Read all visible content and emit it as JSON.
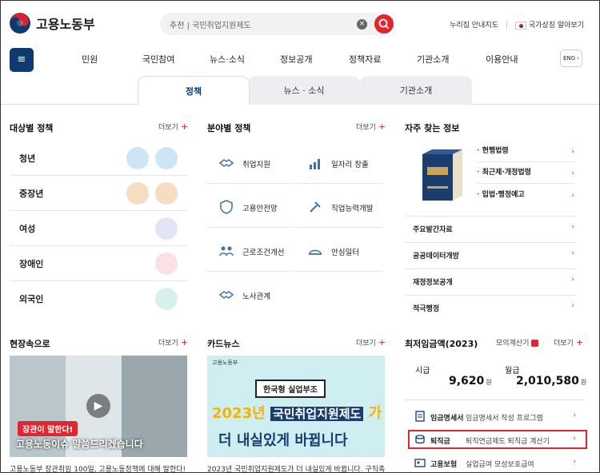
{
  "header": {
    "logo_text": "고용노동부",
    "search_text": "추천 | 국민취업지원제도",
    "links": [
      "누리집 안내지도",
      "국가상징 알아보기"
    ]
  },
  "nav": {
    "items": [
      "민원",
      "국민참여",
      "뉴스·소식",
      "정보공개",
      "정책자료",
      "기관소개",
      "이용안내"
    ],
    "eng": "ENG"
  },
  "tabs": [
    "정책",
    "뉴스 · 소식",
    "기관소개"
  ],
  "target_policy": {
    "title": "대상별 정책",
    "more": "더보기",
    "items": [
      "청년",
      "중장년",
      "여성",
      "장애인",
      "외국인"
    ]
  },
  "field_policy": {
    "title": "분야별 정책",
    "more": "더보기",
    "items": [
      "취업지원",
      "일자리 창출",
      "고용안전망",
      "직업능력개발",
      "근로조건개선",
      "안심일터",
      "노사관계"
    ]
  },
  "frequent": {
    "title": "자주 찾는 정보",
    "law_items": [
      "현행법령",
      "최근제·개정법령",
      "입법·행정예고"
    ],
    "items": [
      "주요발간자료",
      "공공데이터개방",
      "재정정보공개",
      "적극행정"
    ]
  },
  "field": {
    "title": "현장속으로",
    "more": "더보기",
    "video_text": "고용노동이슈 말씀드리겠습니다",
    "video_badge": "장관이 말한다!",
    "caption": "고용노동부 장관취임 100일, 고용노동정책에 대해 말한다!"
  },
  "cardnews": {
    "title": "카드뉴스",
    "more": "더보기",
    "small_logo": "고용노동부",
    "badge": "한국형 실업부조",
    "line1_year": "2023년",
    "line1_name": "국민취업지원제도",
    "line1_end": "가",
    "line2": "더 내실있게 바뀝니다",
    "caption": "2023년 국민취업지원제도가 더 내실있게 바뀝니다. 구직촉진"
  },
  "minwage": {
    "title": "최저임금액(2023)",
    "calc": "모의계산기",
    "more": "더보기",
    "hourly_label": "시급",
    "hourly_value": "9,620",
    "monthly_label": "월급",
    "monthly_value": "2,010,580",
    "unit": "원"
  },
  "utilities": [
    {
      "name": "임금명세서",
      "desc": "임금명세서 작성 프로그램"
    },
    {
      "name": "퇴직금",
      "desc": "퇴직연금제도 퇴직금 계산기"
    },
    {
      "name": "고용보험",
      "desc": "실업급여 모성보호급여"
    }
  ],
  "colors": {
    "accent": "#e0262e",
    "navy": "#0e3a6f"
  }
}
